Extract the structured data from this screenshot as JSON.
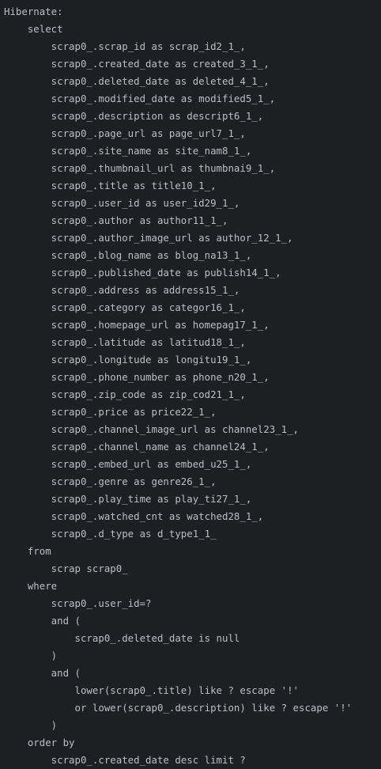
{
  "console": {
    "lines": [
      "Hibernate: ",
      "    select",
      "        scrap0_.scrap_id as scrap_id2_1_,",
      "        scrap0_.created_date as created_3_1_,",
      "        scrap0_.deleted_date as deleted_4_1_,",
      "        scrap0_.modified_date as modified5_1_,",
      "        scrap0_.description as descript6_1_,",
      "        scrap0_.page_url as page_url7_1_,",
      "        scrap0_.site_name as site_nam8_1_,",
      "        scrap0_.thumbnail_url as thumbnai9_1_,",
      "        scrap0_.title as title10_1_,",
      "        scrap0_.user_id as user_id29_1_,",
      "        scrap0_.author as author11_1_,",
      "        scrap0_.author_image_url as author_12_1_,",
      "        scrap0_.blog_name as blog_na13_1_,",
      "        scrap0_.published_date as publish14_1_,",
      "        scrap0_.address as address15_1_,",
      "        scrap0_.category as categor16_1_,",
      "        scrap0_.homepage_url as homepag17_1_,",
      "        scrap0_.latitude as latitud18_1_,",
      "        scrap0_.longitude as longitu19_1_,",
      "        scrap0_.phone_number as phone_n20_1_,",
      "        scrap0_.zip_code as zip_cod21_1_,",
      "        scrap0_.price as price22_1_,",
      "        scrap0_.channel_image_url as channel23_1_,",
      "        scrap0_.channel_name as channel24_1_,",
      "        scrap0_.embed_url as embed_u25_1_,",
      "        scrap0_.genre as genre26_1_,",
      "        scrap0_.play_time as play_ti27_1_,",
      "        scrap0_.watched_cnt as watched28_1_,",
      "        scrap0_.d_type as d_type1_1_ ",
      "    from",
      "        scrap scrap0_ ",
      "    where",
      "        scrap0_.user_id=? ",
      "        and (",
      "            scrap0_.deleted_date is null",
      "        ) ",
      "        and (",
      "            lower(scrap0_.title) like ? escape '!' ",
      "            or lower(scrap0_.description) like ? escape '!'",
      "        ) ",
      "    order by",
      "        scrap0_.created_date desc limit ?"
    ]
  }
}
